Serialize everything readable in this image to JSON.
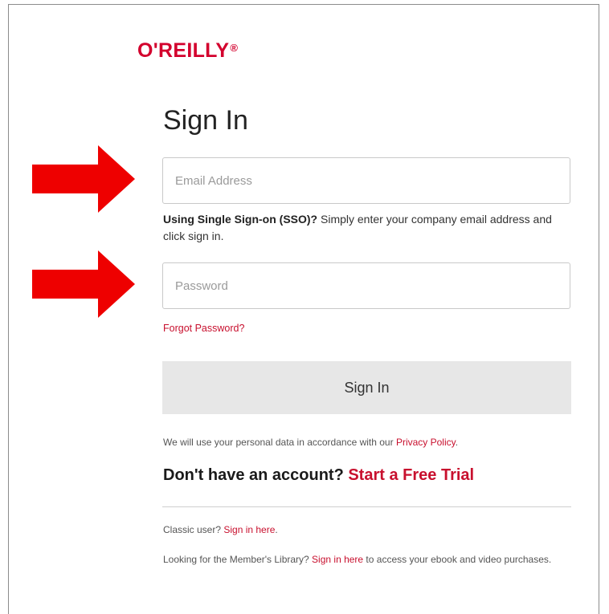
{
  "brand": {
    "logo_text": "O'REILLY",
    "trademark": "®",
    "color": "#d3002d"
  },
  "form": {
    "title": "Sign In",
    "email_placeholder": "Email Address",
    "password_placeholder": "Password",
    "sso_bold": "Using Single Sign-on (SSO)?",
    "sso_text": " Simply enter your company email address and click sign in.",
    "forgot_password": "Forgot Password?",
    "submit_label": "Sign In"
  },
  "privacy": {
    "text": "We will use your personal data in accordance with our ",
    "link": "Privacy Policy",
    "end": "."
  },
  "signup": {
    "text": "Don't have an account? ",
    "link": "Start a Free Trial"
  },
  "footer": {
    "classic_text": "Classic user? ",
    "classic_link": "Sign in here",
    "classic_end": ".",
    "member_text": "Looking for the Member's Library? ",
    "member_link": "Sign in here",
    "member_end": " to access your ebook and video purchases."
  },
  "annotations": {
    "arrow_color": "#ee0000",
    "arrow_icon": "right-arrow-icon"
  },
  "colors": {
    "link": "#c8102e",
    "button_bg": "#e7e7e7",
    "input_border": "#c9c9c9"
  }
}
